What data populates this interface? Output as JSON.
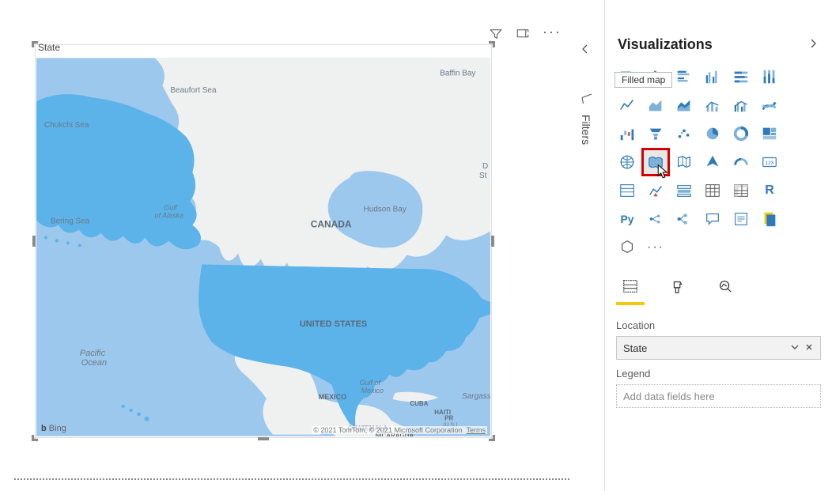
{
  "visual": {
    "title": "State",
    "map_labels": {
      "canada": "CANADA",
      "united_states": "UNITED STATES",
      "mexico": "MEXICO",
      "cuba": "CUBA",
      "haiti": "HAITI",
      "pr": "PR",
      "pr_sub": "(U.S.)",
      "guatemala": "GUATEMALA",
      "nicaragua": "NICARAGUA",
      "baffin_bay": "Baffin Bay",
      "beaufort_sea": "Beaufort Sea",
      "chukchi_sea": "Chukchi Sea",
      "bering_sea": "Bering Sea",
      "hudson_bay": "Hudson Bay",
      "gulf_alaska1": "Gulf",
      "gulf_alaska2": "of Alaska",
      "gulf_mexico1": "Gulf of",
      "gulf_mexico2": "Mexico",
      "pacific1": "Pacific",
      "pacific2": "Ocean",
      "sargasso": "Sargass",
      "davis": "D",
      "davis2": "St"
    },
    "attribution": "© 2021 TomTom, © 2021 Microsoft Corporation",
    "attribution_terms": "Terms",
    "bing": "Bing"
  },
  "filters_label": "Filters",
  "panel": {
    "title": "Visualizations",
    "tooltip_filled_map": "Filled map",
    "viz_names": [
      "stacked-bar",
      "stacked-column",
      "clustered-bar",
      "clustered-column",
      "100-stacked-bar",
      "100-stacked-column",
      "line",
      "area",
      "stacked-area",
      "line-stacked-column",
      "line-clustered-column",
      "ribbon",
      "waterfall",
      "funnel",
      "scatter",
      "pie",
      "donut",
      "treemap",
      "map",
      "filled-map",
      "shape-map",
      "azure-map",
      "gauge",
      "card",
      "multi-row-card",
      "kpi",
      "slicer",
      "table",
      "matrix",
      "r-visual",
      "python",
      "key-influencers",
      "decomposition",
      "qna",
      "narrative",
      "paginated"
    ],
    "python_label": "Py",
    "r_label": "R"
  },
  "fields": {
    "location_label": "Location",
    "location_value": "State",
    "legend_label": "Legend",
    "legend_placeholder": "Add data fields here"
  }
}
